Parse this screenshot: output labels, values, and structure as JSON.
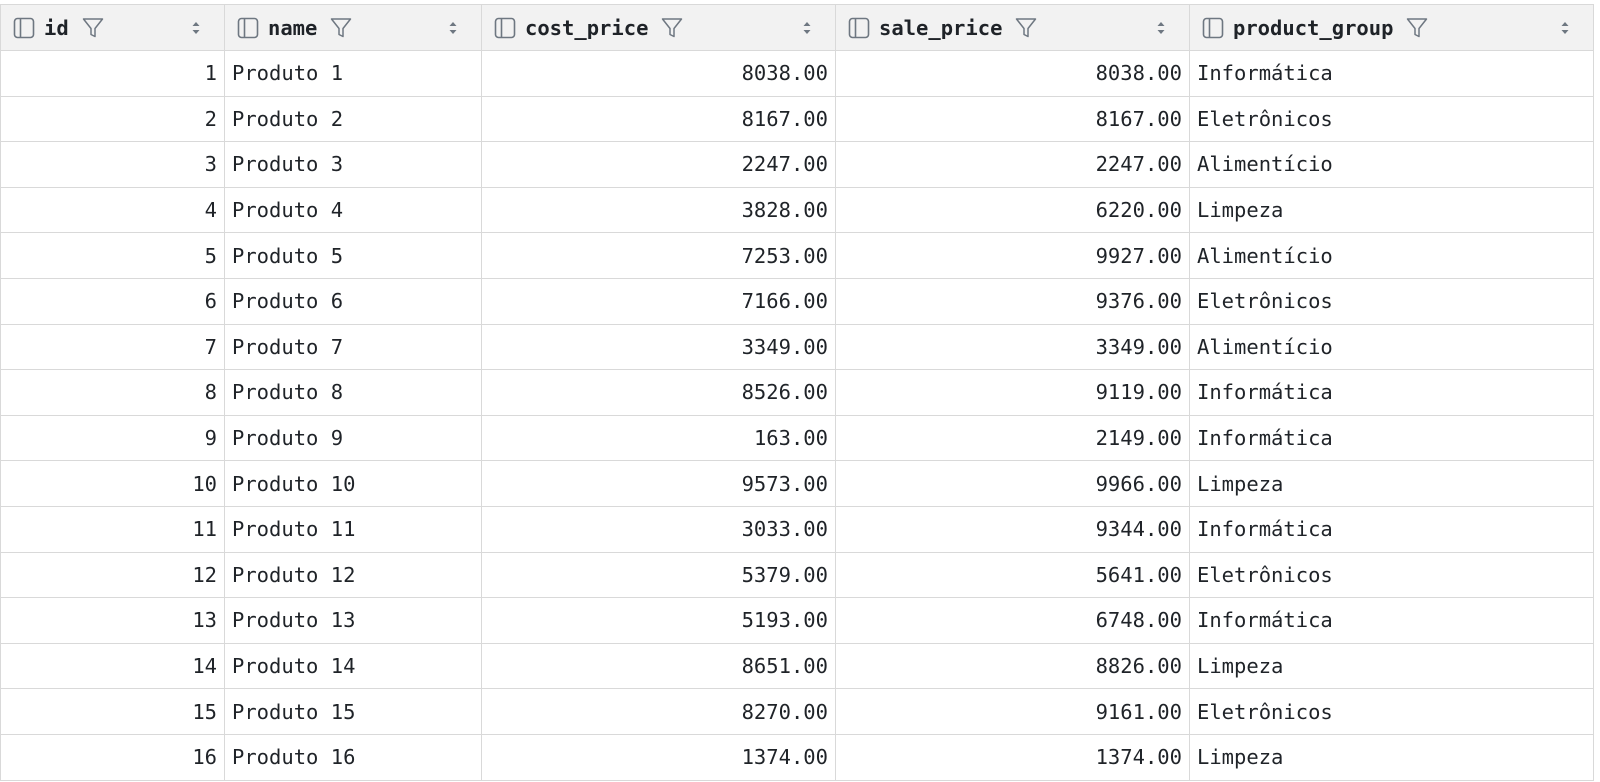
{
  "table": {
    "columns": [
      {
        "name": "id",
        "align": "right"
      },
      {
        "name": "name",
        "align": "left"
      },
      {
        "name": "cost_price",
        "align": "right"
      },
      {
        "name": "sale_price",
        "align": "right"
      },
      {
        "name": "product_group",
        "align": "left"
      }
    ],
    "rows": [
      [
        "1",
        "Produto 1",
        "8038.00",
        "8038.00",
        "Informática"
      ],
      [
        "2",
        "Produto 2",
        "8167.00",
        "8167.00",
        "Eletrônicos"
      ],
      [
        "3",
        "Produto 3",
        "2247.00",
        "2247.00",
        "Alimentício"
      ],
      [
        "4",
        "Produto 4",
        "3828.00",
        "6220.00",
        "Limpeza"
      ],
      [
        "5",
        "Produto 5",
        "7253.00",
        "9927.00",
        "Alimentício"
      ],
      [
        "6",
        "Produto 6",
        "7166.00",
        "9376.00",
        "Eletrônicos"
      ],
      [
        "7",
        "Produto 7",
        "3349.00",
        "3349.00",
        "Alimentício"
      ],
      [
        "8",
        "Produto 8",
        "8526.00",
        "9119.00",
        "Informática"
      ],
      [
        "9",
        "Produto 9",
        "163.00",
        "2149.00",
        "Informática"
      ],
      [
        "10",
        "Produto 10",
        "9573.00",
        "9966.00",
        "Limpeza"
      ],
      [
        "11",
        "Produto 11",
        "3033.00",
        "9344.00",
        "Informática"
      ],
      [
        "12",
        "Produto 12",
        "5379.00",
        "5641.00",
        "Eletrônicos"
      ],
      [
        "13",
        "Produto 13",
        "5193.00",
        "6748.00",
        "Informática"
      ],
      [
        "14",
        "Produto 14",
        "8651.00",
        "8826.00",
        "Limpeza"
      ],
      [
        "15",
        "Produto 15",
        "8270.00",
        "9161.00",
        "Eletrônicos"
      ],
      [
        "16",
        "Produto 16",
        "1374.00",
        "1374.00",
        "Limpeza"
      ]
    ]
  },
  "icons": {
    "column": "column-icon",
    "filter": "filter-icon",
    "sort": "sort-icon"
  },
  "colors": {
    "header_bg": "#f2f2f2",
    "border": "#d9d9d9",
    "text": "#1f2328",
    "icon": "#6e7781"
  }
}
